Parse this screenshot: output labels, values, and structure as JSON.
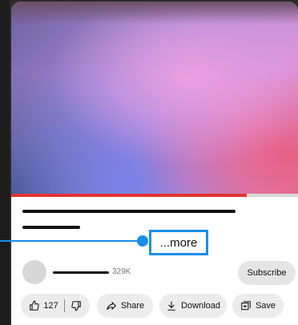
{
  "video": {
    "progress_fraction": 0.82
  },
  "description": {
    "more_label": "...more"
  },
  "channel": {
    "subscribers": "329K",
    "subscribe_label": "Subscribe"
  },
  "actions": {
    "like_count": "127",
    "share_label": "Share",
    "download_label": "Download",
    "save_label": "Save"
  },
  "colors": {
    "progress": "#e3342f",
    "callout": "#1b8ee8"
  },
  "icons": [
    "thumbs-up-icon",
    "thumbs-down-icon",
    "share-arrow-icon",
    "download-icon",
    "save-playlist-icon"
  ]
}
